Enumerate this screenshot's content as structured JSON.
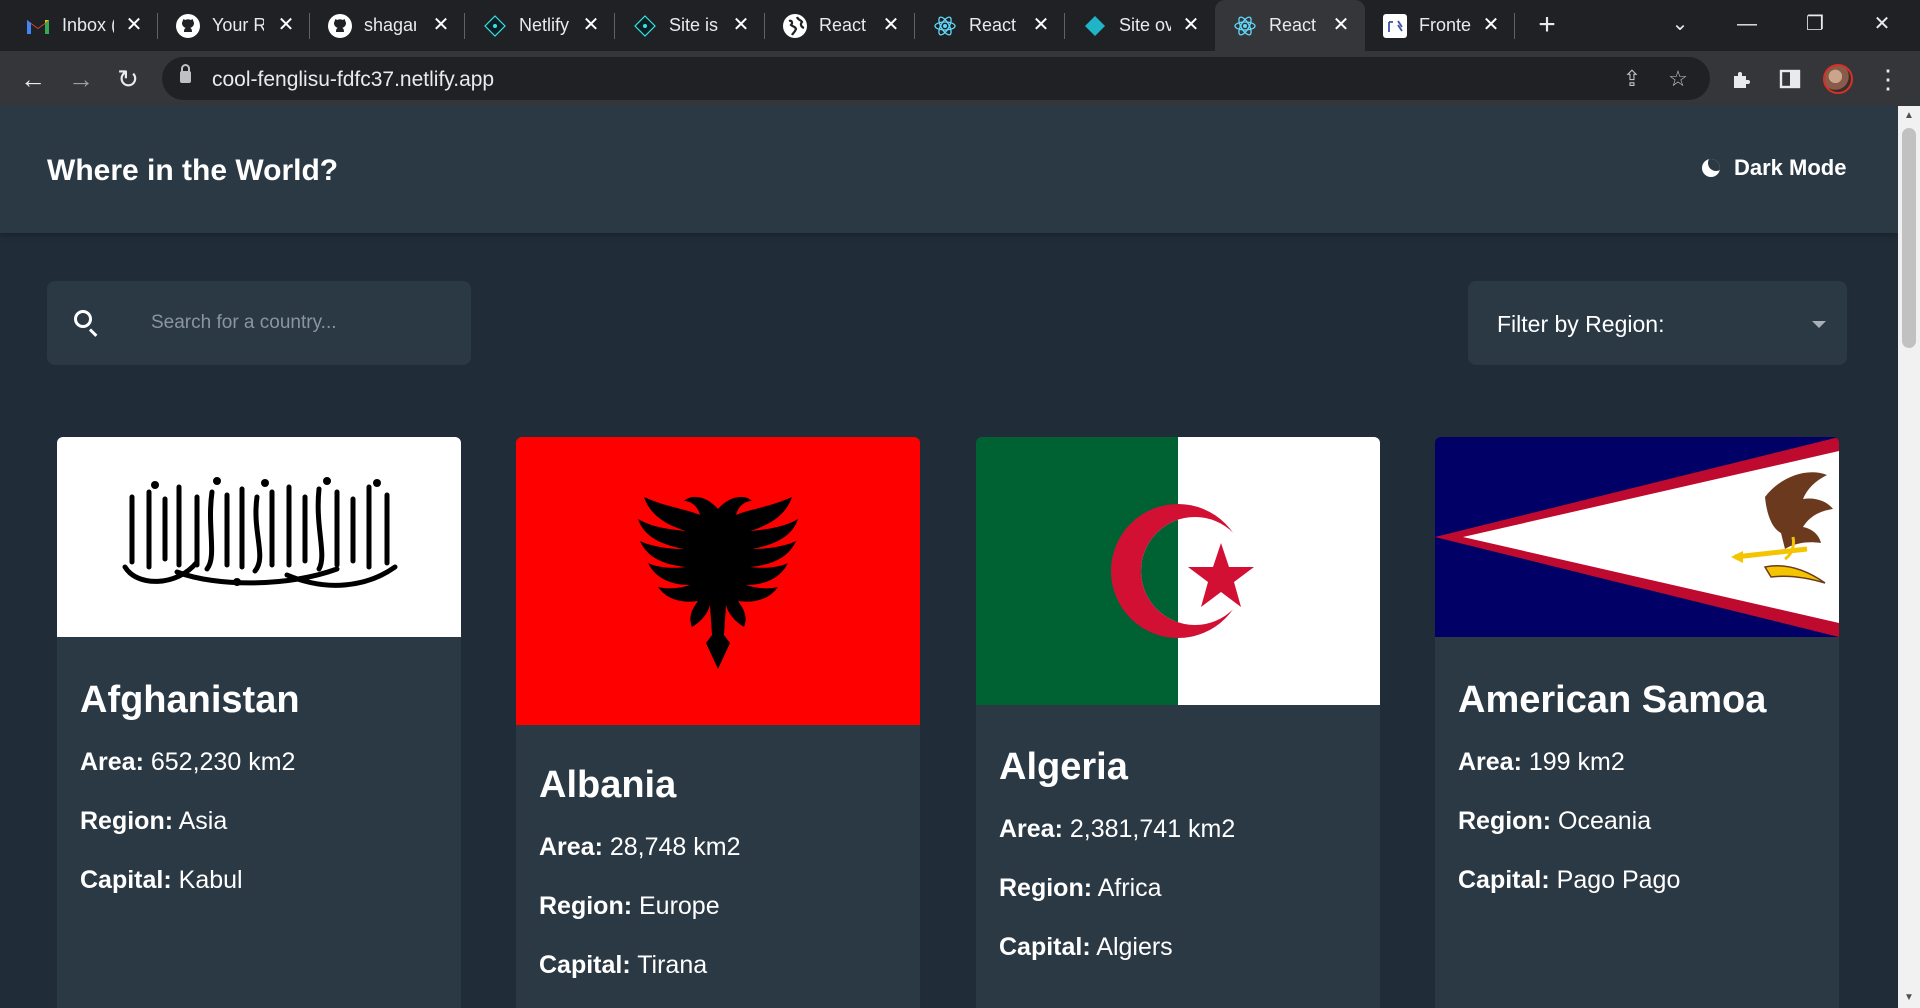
{
  "browser": {
    "tabs": [
      {
        "title": "Inbox (",
        "icon": "gmail-icon",
        "active": false
      },
      {
        "title": "Your R",
        "icon": "github-icon",
        "active": false
      },
      {
        "title": "shagar",
        "icon": "github-icon",
        "active": false
      },
      {
        "title": "Netlify",
        "icon": "netlify-icon",
        "active": false
      },
      {
        "title": "Site is",
        "icon": "netlify-icon",
        "active": false
      },
      {
        "title": "React /",
        "icon": "globe-icon",
        "active": false
      },
      {
        "title": "React /",
        "icon": "react-icon",
        "active": false
      },
      {
        "title": "Site ov",
        "icon": "netlify-diamond-icon",
        "active": false
      },
      {
        "title": "React /",
        "icon": "react-icon",
        "active": true
      },
      {
        "title": "Fronte",
        "icon": "frontend-mentor-icon",
        "active": false
      }
    ],
    "url": "cool-fenglisu-fdfc37.netlify.app"
  },
  "app": {
    "title": "Where in the World?",
    "dark_mode_label": "Dark Mode",
    "search": {
      "placeholder": "Search for a country...",
      "value": ""
    },
    "filter": {
      "label": "Filter by Region:"
    }
  },
  "labels": {
    "area": "Area:",
    "region": "Region:",
    "capital": "Capital:"
  },
  "countries": [
    {
      "name": "Afghanistan",
      "area": "652,230 km2",
      "region": "Asia",
      "capital": "Kabul",
      "flag": "afghanistan-flag"
    },
    {
      "name": "Albania",
      "area": "28,748 km2",
      "region": "Europe",
      "capital": "Tirana",
      "flag": "albania-flag"
    },
    {
      "name": "Algeria",
      "area": "2,381,741 km2",
      "region": "Africa",
      "capital": "Algiers",
      "flag": "algeria-flag"
    },
    {
      "name": "American Samoa",
      "area": "199 km2",
      "region": "Oceania",
      "capital": "Pago Pago",
      "flag": "american-samoa-flag"
    }
  ],
  "colors": {
    "background": "#202c37",
    "surface": "#2b3945",
    "text": "#ffffff",
    "albania_red": "#ff0000",
    "algeria_green": "#006233",
    "algeria_red": "#d21034",
    "samoa_blue": "#000066",
    "samoa_red": "#bf0a30"
  }
}
